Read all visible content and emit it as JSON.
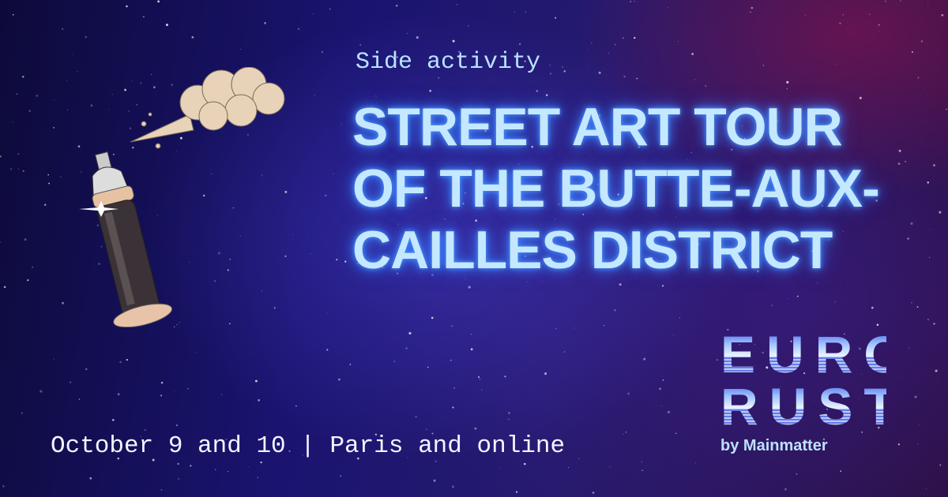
{
  "subtitle": "Side activity",
  "title_lines": [
    "Street Art Tour",
    "of the Butte-aux-",
    "Cailles District"
  ],
  "footer": "October 9 and 10 | Paris and online",
  "logo": {
    "line1": "EURO",
    "line2": "RUST",
    "by_prefix": "by",
    "by_name": "Mainmatter"
  },
  "colors": {
    "title": "#c4e8ff",
    "glow": "#3a7cff",
    "background": "#1a1470"
  }
}
